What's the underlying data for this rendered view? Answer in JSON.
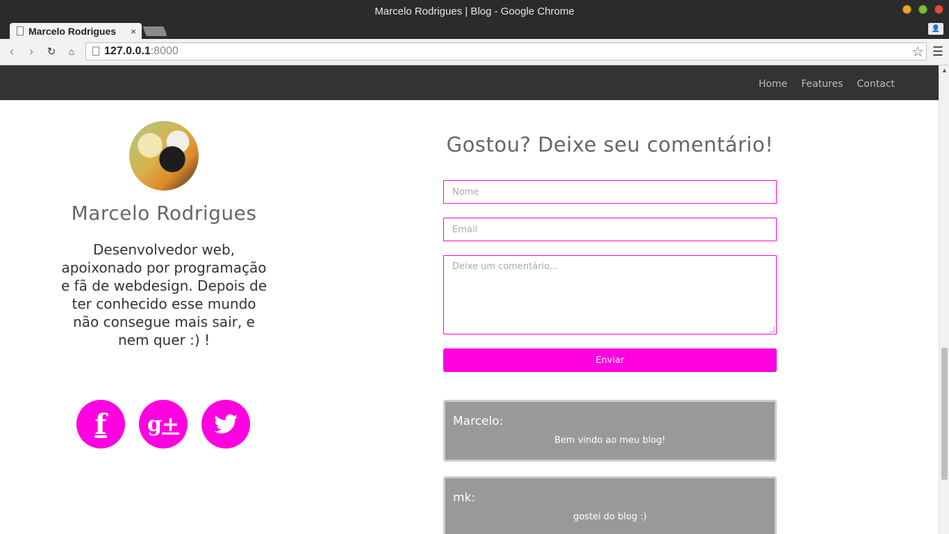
{
  "window": {
    "title": "Marcelo Rodrigues | Blog - Google Chrome"
  },
  "browser": {
    "tab_title": "Marcelo Rodrigues",
    "tab_close": "×",
    "url_host": "127.0.0.1",
    "url_port": ":8000"
  },
  "nav": {
    "links": [
      "Home",
      "Features",
      "Contact"
    ]
  },
  "profile": {
    "name": "Marcelo Rodrigues",
    "bio": "Desenvolvedor web, apoixonado por programação e fã de webdesign. Depois de ter conhecido esse mundo não consegue mais sair, e nem quer :) !",
    "social": [
      {
        "icon": "facebook-icon",
        "glyph": "f"
      },
      {
        "icon": "google-plus-icon",
        "glyph": "g+"
      },
      {
        "icon": "twitter-icon",
        "glyph": "🐦"
      }
    ]
  },
  "comment_form": {
    "heading": "Gostou? Deixe seu comentário!",
    "name_placeholder": "Nome",
    "email_placeholder": "Email",
    "comment_placeholder": "Deixe um comentário...",
    "submit_label": "Enviar"
  },
  "comments": [
    {
      "author": "Marcelo:",
      "text": "Bem vindo ao meu blog!"
    },
    {
      "author": "mk:",
      "text": "gostei do blog :)"
    }
  ],
  "colors": {
    "accent": "#ff00e1",
    "navbar": "#333333",
    "comment_bg": "#999999"
  }
}
